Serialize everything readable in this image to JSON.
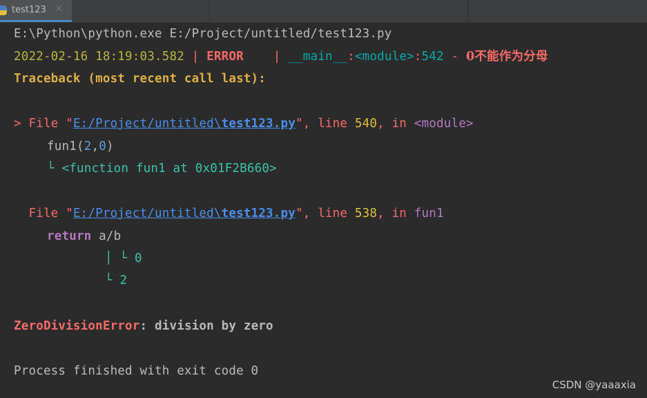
{
  "tab": {
    "label": "test123",
    "close": "×"
  },
  "console": {
    "cmd": "E:\\Python\\python.exe E:/Project/untitled/test123.py",
    "log": {
      "timestamp": "2022-02-16 18:19:03.582",
      "sep1": " | ",
      "level": "ERROR   ",
      "sep2": " | ",
      "main": "__main__",
      "colon1": ":",
      "module": "<module>",
      "colon2": ":",
      "lineno": "542",
      "dash": " - ",
      "message": "0不能作为分母"
    },
    "traceback_header": "Traceback (most recent call last):",
    "frame1": {
      "prefix": "> File \"",
      "path": "E:/Project/untitled\\",
      "file": "test123.py",
      "quote": "\"",
      "comma_line": ", line ",
      "lineno": "540",
      "comma_in": ", in ",
      "func": "<module>",
      "code_fn": "fun1(",
      "code_a": "2",
      "code_comma": ",",
      "code_b": "0",
      "code_close": ")",
      "var_marker": "└ ",
      "var_value": "<function fun1 at 0x01F2B660>"
    },
    "frame2": {
      "prefix": "  File \"",
      "path": "E:/Project/untitled\\",
      "file": "test123.py",
      "quote": "\"",
      "comma_line": ", line ",
      "lineno": "538",
      "comma_in": ", in ",
      "func": "fun1",
      "code_kw": "return",
      "code_expr": " a/b",
      "var1_marker": "│ └ ",
      "var1_value": "0",
      "var2_marker": "└ ",
      "var2_value": "2"
    },
    "exception": {
      "name": "ZeroDivisionError",
      "colon": ":",
      "message": " division by zero"
    },
    "exit": "Process finished with exit code 0"
  },
  "watermark": "CSDN @yaaaxia",
  "colors": {
    "background": "#2b2b2b",
    "error_red": "#ff6b68",
    "link_blue": "#4a8ff0",
    "tab_underline": "#4a88c7"
  }
}
